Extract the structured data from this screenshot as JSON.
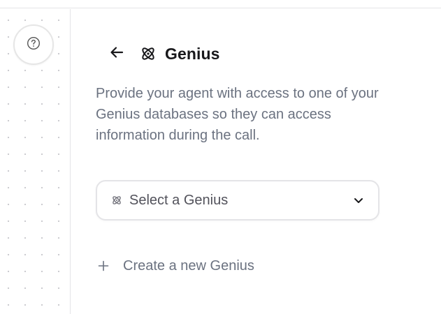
{
  "sidebar": {
    "help_icon": "question-circle-icon"
  },
  "panel": {
    "back_icon": "arrow-left-icon",
    "title_icon": "atom-icon",
    "title": "Genius",
    "description": "Provide your agent with access to one of your Genius databases so they can access information during the call.",
    "select": {
      "icon": "atom-icon",
      "placeholder": "Select a Genius",
      "chevron": "chevron-down-icon"
    },
    "create": {
      "icon": "plus-icon",
      "label": "Create a new Genius"
    }
  },
  "colors": {
    "text_primary": "#18181b",
    "text_muted": "#6b7280",
    "border": "#e4e4e7"
  }
}
